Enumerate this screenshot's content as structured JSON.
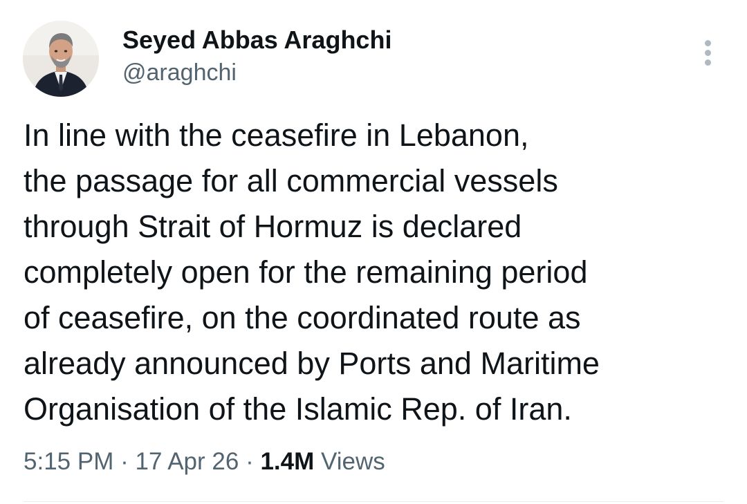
{
  "author": {
    "name": "Seyed Abbas Araghchi",
    "handle": "@araghchi"
  },
  "tweet": {
    "lines": [
      "In line with the ceasefire in Lebanon,",
      "the passage for all commercial vessels",
      "through Strait of Hormuz is declared",
      "completely open for the remaining period",
      "of ceasefire, on the coordinated route as",
      "already announced by Ports and Maritime",
      "Organisation of the Islamic Rep. of Iran."
    ]
  },
  "meta": {
    "time": "5:15 PM",
    "separator": "·",
    "date": "17 Apr 26",
    "views_count": "1.4M",
    "views_label": "Views"
  },
  "icons": {
    "more": "more-vertical-icon",
    "avatar": "profile-photo"
  }
}
